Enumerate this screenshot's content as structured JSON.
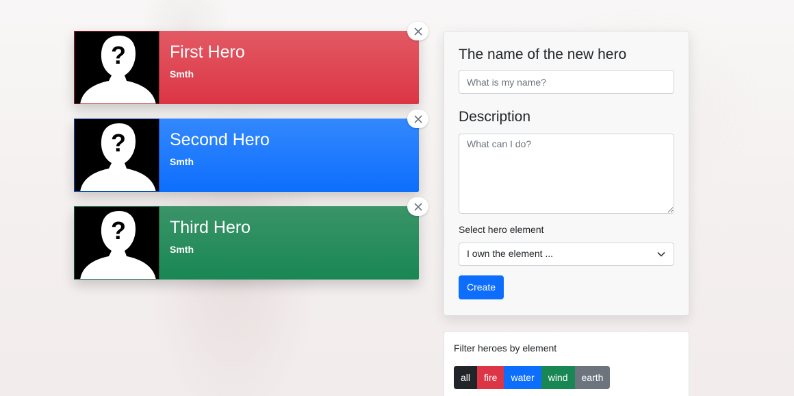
{
  "heroes": [
    {
      "name": "First Hero",
      "description": "Smth",
      "element": "fire"
    },
    {
      "name": "Second Hero",
      "description": "Smth",
      "element": "water"
    },
    {
      "name": "Third Hero",
      "description": "Smth",
      "element": "wind"
    }
  ],
  "form": {
    "name_label": "The name of the new hero",
    "name_placeholder": "What is my name?",
    "description_label": "Description",
    "description_placeholder": "What can I do?",
    "select_label": "Select hero element",
    "select_value": "I own the element ...",
    "create_label": "Create"
  },
  "filter": {
    "title": "Filter heroes by element",
    "buttons": [
      {
        "label": "all",
        "color": "#212529"
      },
      {
        "label": "fire",
        "color": "#dc3545"
      },
      {
        "label": "water",
        "color": "#0d6efd"
      },
      {
        "label": "wind",
        "color": "#198754"
      },
      {
        "label": "earth",
        "color": "#6c757d"
      }
    ]
  },
  "icons": {
    "avatar": "unknown-person-silhouette",
    "close": "close-x",
    "select_arrow": "chevron-down"
  }
}
